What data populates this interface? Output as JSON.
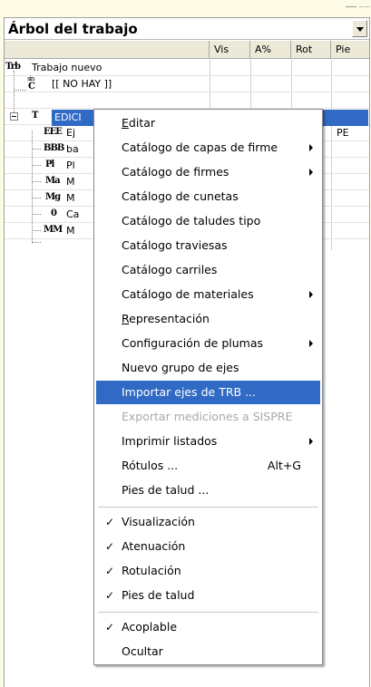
{
  "panel": {
    "title": "Árbol del trabajo",
    "columns": [
      "Vis",
      "A%",
      "Rot",
      "Pie"
    ]
  },
  "tree": {
    "root": {
      "icon": "Trb",
      "label": "Trabajo nuevo"
    },
    "none_item": {
      "icon_top": "sin",
      "icon_bottom": "C",
      "label": "[[ NO HAY ]]"
    },
    "selected": {
      "icon": "T",
      "label": "EDICI"
    },
    "children": [
      {
        "icon": "EEE",
        "label": "Ej",
        "pie": "PE"
      },
      {
        "icon": "BBB",
        "label": "ba",
        "pie": ""
      },
      {
        "icon": "Pl",
        "label": "Pl",
        "pie": ""
      },
      {
        "icon": "Ma",
        "label": "M",
        "pie": ""
      },
      {
        "icon": "Mg",
        "label": "M",
        "pie": ""
      },
      {
        "icon": "0",
        "label": "Ca",
        "pie": ""
      },
      {
        "icon": "MM",
        "label": "M",
        "pie": ""
      }
    ]
  },
  "menu": {
    "items": [
      {
        "label": "Editar",
        "underline": "E",
        "rest": "ditar"
      },
      {
        "label": "Catálogo de capas de firme",
        "submenu": true
      },
      {
        "label": "Catálogo de firmes",
        "submenu": true
      },
      {
        "label": "Catálogo de cunetas"
      },
      {
        "label": "Catálogo de taludes tipo"
      },
      {
        "label": "Catálogo traviesas"
      },
      {
        "label": "Catálogo carriles"
      },
      {
        "label": "Catálogo de materiales",
        "submenu": true
      },
      {
        "label": "Representación",
        "underline": "R",
        "rest": "epresentación"
      },
      {
        "label": "Configuración de plumas",
        "submenu": true
      },
      {
        "label": "Nuevo grupo de ejes"
      },
      {
        "label": "Importar ejes de TRB ...",
        "highlighted": true
      },
      {
        "label": "Exportar mediciones a SISPRE",
        "disabled": true
      },
      {
        "label": "Imprimir listados",
        "submenu": true
      },
      {
        "label": "Rótulos ...",
        "shortcut": "Alt+G"
      },
      {
        "label": "Pies de talud ..."
      }
    ],
    "check_items": [
      {
        "label": "Visualización",
        "checked": "✓"
      },
      {
        "label": "Atenuación",
        "checked": "✓"
      },
      {
        "label": "Rotulación",
        "checked": "✓"
      },
      {
        "label": "Pies de talud",
        "checked": "✓"
      }
    ],
    "bottom_items": [
      {
        "label": "Acoplable",
        "checked": "✓"
      },
      {
        "label": "Ocultar"
      }
    ]
  },
  "colors": {
    "highlight": "#316ac5",
    "panel_bg": "#fdfbe6",
    "disabled": "#a8a8a8"
  }
}
